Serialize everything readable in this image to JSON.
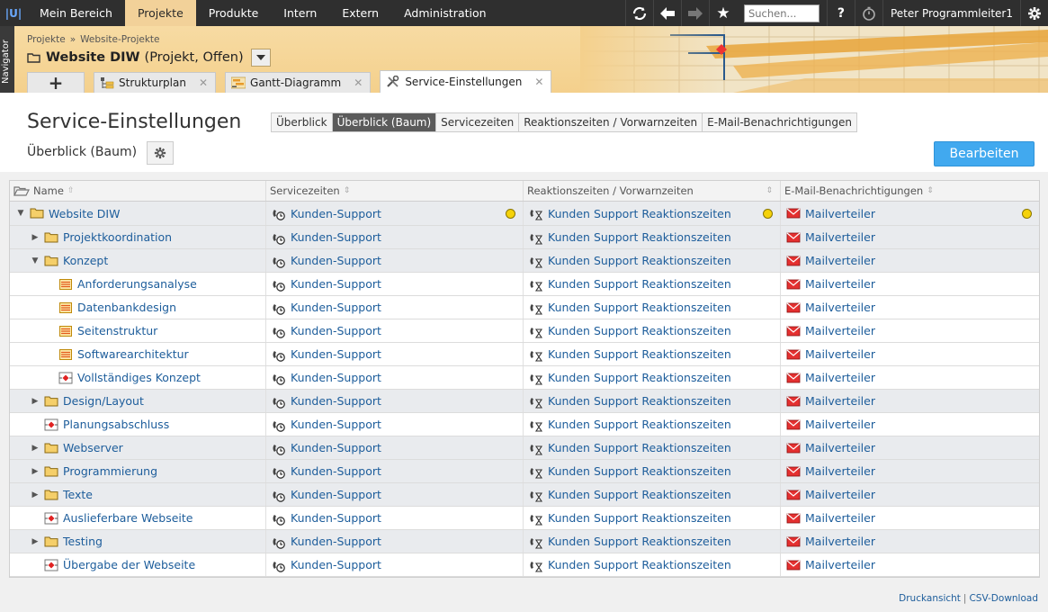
{
  "topnav": {
    "logo": "|U|",
    "items": [
      "Mein Bereich",
      "Projekte",
      "Produkte",
      "Intern",
      "Extern",
      "Administration"
    ],
    "active_index": 1,
    "search_placeholder": "Suchen...",
    "help": "?",
    "user": "Peter Programmleiter1",
    "icons": [
      "refresh-icon",
      "back-icon",
      "forward-icon",
      "star-icon",
      "help-icon",
      "timer-icon",
      "gear-icon"
    ]
  },
  "navigator_label": "Navigator",
  "breadcrumb": [
    "Projekte",
    "Website-Projekte"
  ],
  "breadcrumb_sep": "»",
  "project": {
    "title": "Website DIW",
    "subtitle": "(Projekt, Offen)"
  },
  "tabs": [
    {
      "label": "Strukturplan",
      "icon": "structure-icon"
    },
    {
      "label": "Gantt-Diagramm",
      "icon": "gantt-icon"
    },
    {
      "label": "Service-Einstellungen",
      "icon": "tools-icon"
    }
  ],
  "add_tab": "+",
  "page": {
    "title": "Service-Einstellungen",
    "subview": "Überblick (Baum)",
    "edit_button": "Bearbeiten"
  },
  "view_tabs": [
    "Überblick",
    "Überblick (Baum)",
    "Servicezeiten",
    "Reaktionszeiten / Vorwarnzeiten",
    "E-Mail-Benachrichtigungen"
  ],
  "view_tabs_active": 1,
  "table": {
    "headers": [
      "Name",
      "Servicezeiten",
      "Reaktionszeiten / Vorwarnzeiten",
      "E-Mail-Benachrichtigungen"
    ],
    "service_value": "Kunden-Support",
    "reaction_value": "Kunden Support Reaktionszeiten",
    "mail_value": "Mailverteiler",
    "rows": [
      {
        "name": "Website DIW",
        "level": 0,
        "toggle": "expanded",
        "icon": "folder-icon",
        "dot": true
      },
      {
        "name": "Projektkoordination",
        "level": 1,
        "toggle": "collapsed",
        "icon": "folder-icon",
        "dot": false
      },
      {
        "name": "Konzept",
        "level": 1,
        "toggle": "expanded",
        "icon": "folder-icon",
        "dot": false
      },
      {
        "name": "Anforderungsanalyse",
        "level": 2,
        "toggle": "none",
        "icon": "task-icon",
        "dot": false
      },
      {
        "name": "Datenbankdesign",
        "level": 2,
        "toggle": "none",
        "icon": "task-icon",
        "dot": false
      },
      {
        "name": "Seitenstruktur",
        "level": 2,
        "toggle": "none",
        "icon": "task-icon",
        "dot": false
      },
      {
        "name": "Softwarearchitektur",
        "level": 2,
        "toggle": "none",
        "icon": "task-icon",
        "dot": false
      },
      {
        "name": "Vollständiges Konzept",
        "level": 2,
        "toggle": "none",
        "icon": "milestone-icon",
        "dot": false
      },
      {
        "name": "Design/Layout",
        "level": 1,
        "toggle": "collapsed",
        "icon": "folder-icon",
        "dot": false
      },
      {
        "name": "Planungsabschluss",
        "level": 1,
        "toggle": "none",
        "icon": "milestone-icon",
        "dot": false
      },
      {
        "name": "Webserver",
        "level": 1,
        "toggle": "collapsed",
        "icon": "folder-icon",
        "dot": false
      },
      {
        "name": "Programmierung",
        "level": 1,
        "toggle": "collapsed",
        "icon": "folder-icon",
        "dot": false
      },
      {
        "name": "Texte",
        "level": 1,
        "toggle": "collapsed",
        "icon": "folder-icon",
        "dot": false
      },
      {
        "name": "Auslieferbare Webseite",
        "level": 1,
        "toggle": "none",
        "icon": "milestone-icon",
        "dot": false
      },
      {
        "name": "Testing",
        "level": 1,
        "toggle": "collapsed",
        "icon": "folder-icon",
        "dot": false
      },
      {
        "name": "Übergabe der Webseite",
        "level": 1,
        "toggle": "none",
        "icon": "milestone-icon",
        "dot": false
      }
    ]
  },
  "footer": {
    "print": "Druckansicht",
    "sep": "|",
    "csv": "CSV-Download"
  },
  "colors": {
    "link": "#1d5d9b",
    "accent": "#41a9ef",
    "status_dot": "#f5d20a",
    "active_nav": "#f2d199"
  }
}
